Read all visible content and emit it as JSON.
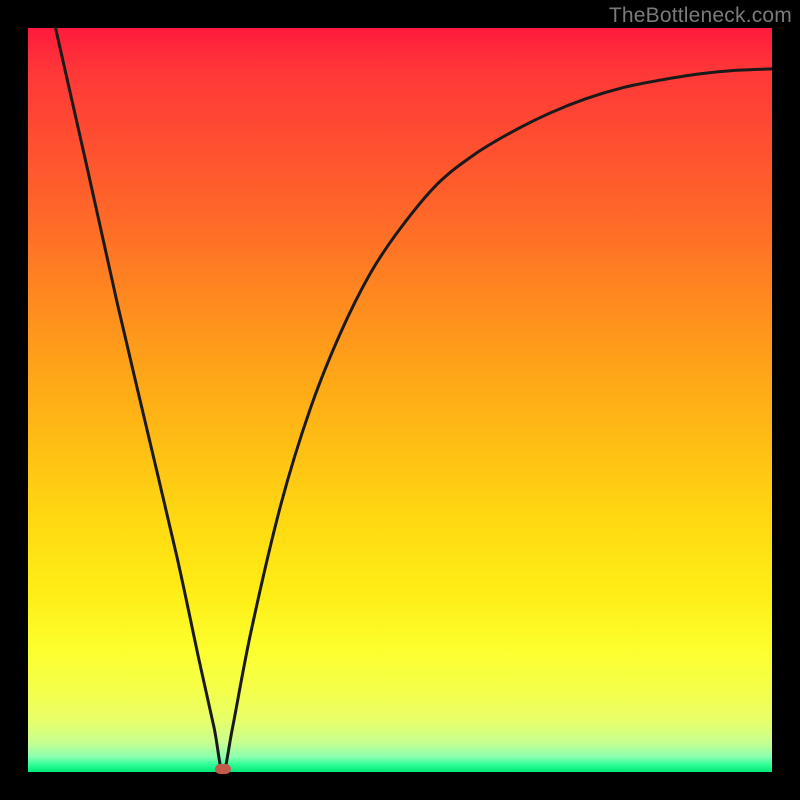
{
  "watermark": "TheBottleneck.com",
  "marker": {
    "x_frac": 0.262,
    "y_frac": 0.996,
    "color": "#c45a4a"
  },
  "chart_data": {
    "type": "line",
    "title": "",
    "xlabel": "",
    "ylabel": "",
    "xlim": [
      0,
      1
    ],
    "ylim": [
      0,
      1
    ],
    "x": [
      0.037,
      0.08,
      0.12,
      0.16,
      0.2,
      0.23,
      0.25,
      0.262,
      0.275,
      0.3,
      0.34,
      0.38,
      0.42,
      0.46,
      0.5,
      0.55,
      0.6,
      0.65,
      0.7,
      0.75,
      0.8,
      0.85,
      0.9,
      0.95,
      1.0
    ],
    "values": [
      1.0,
      0.81,
      0.63,
      0.46,
      0.29,
      0.15,
      0.06,
      0.0,
      0.06,
      0.19,
      0.36,
      0.49,
      0.59,
      0.67,
      0.73,
      0.79,
      0.83,
      0.86,
      0.885,
      0.905,
      0.92,
      0.93,
      0.938,
      0.943,
      0.945
    ],
    "note": "x and y in axis-fraction units (0–1); y=1 is plotted at the TOP of the area; the curve minimum at x≈0.262 reaches y=0 (bottom/green)."
  }
}
